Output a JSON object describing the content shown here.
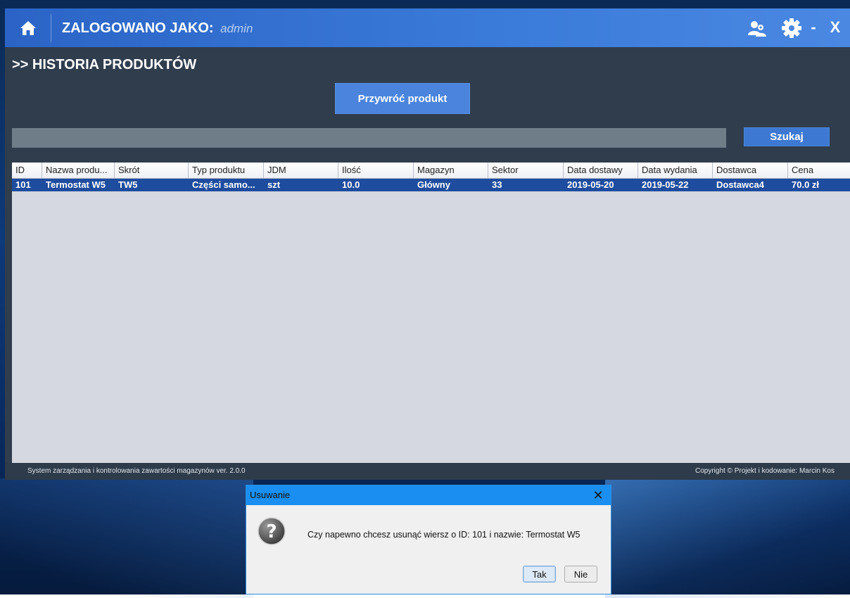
{
  "header": {
    "logged_label": "ZALOGOWANO JAKO:",
    "user": "admin",
    "minimize": "-",
    "close": "X"
  },
  "page": {
    "title": ">> HISTORIA PRODUKTÓW",
    "restore_button": "Przywróć produkt",
    "search_value": "",
    "search_button": "Szukaj"
  },
  "table": {
    "columns": [
      "ID",
      "Nazwa produ...",
      "Skrót",
      "Typ produktu",
      "JDM",
      "Ilość",
      "Magazyn",
      "Sektor",
      "Data dostawy",
      "Data wydania",
      "Dostawca",
      "Cena"
    ],
    "rows": [
      [
        "101",
        "Termostat W5",
        "TW5",
        "Części samo...",
        "szt",
        "10.0",
        "Główny",
        "33",
        "2019-05-20",
        "2019-05-22",
        "Dostawca4",
        "70.0 zł"
      ]
    ],
    "selected_row": 0
  },
  "status": {
    "left": "System zarządzania i kontrolowania zawartości magazynów ver. 2.0.0",
    "right": "Copyright © Projekt i kodowanie: Marcin Kos"
  },
  "dialog": {
    "title": "Usuwanie",
    "message": "Czy napewno chcesz usunąć wiersz o ID: 101 i nazwie: Termostat W5",
    "yes": "Tak",
    "no": "Nie",
    "close": "✕"
  },
  "colors": {
    "header_blue": "#3b7bd9",
    "app_bg": "#2f3d4d",
    "selected_row": "#1e4c9e",
    "dialog_title": "#1b8ff1"
  },
  "icons": [
    "home-icon",
    "users-icon",
    "gear-icon",
    "question-icon"
  ]
}
